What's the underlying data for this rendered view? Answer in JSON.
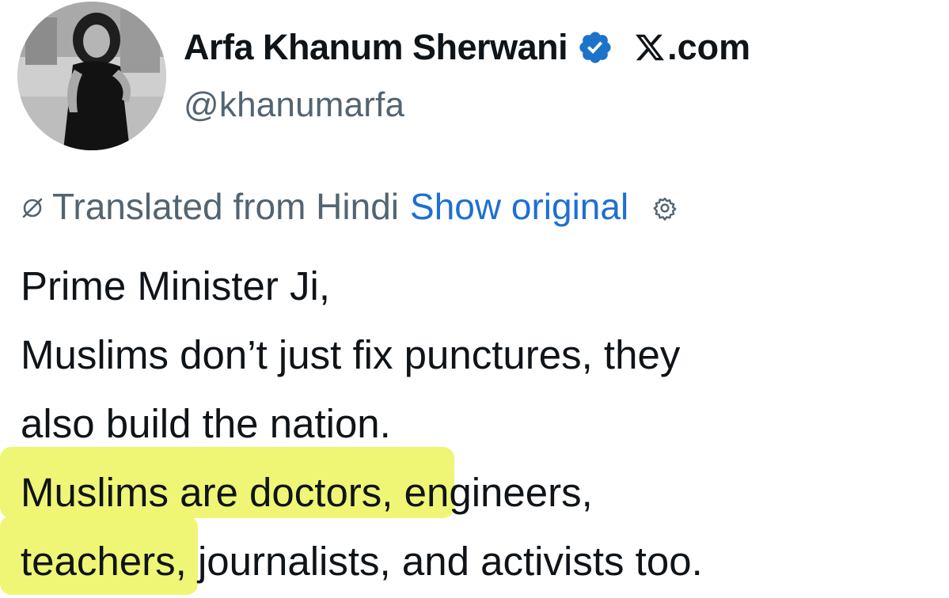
{
  "author": {
    "display_name": "Arfa Khanum Sherwani",
    "handle": "@khanumarfa",
    "verified_icon": "verified-badge-icon",
    "site_label": ".com",
    "site_logo_icon": "x-logo-icon"
  },
  "translation": {
    "label": "Translated from Hindi",
    "show_original": "Show original",
    "icon": "translate-icon",
    "settings_icon": "gear-icon"
  },
  "tweet": {
    "line1": "Prime Minister Ji,",
    "line2": "Muslims don’t just fix punctures, they",
    "line3": "also build the nation.",
    "line4_highlight": "Muslims are doctor",
    "line4_rest": "s, engineers,",
    "line5_highlight": "teacher",
    "line5_rest": "s, journalists, and activists too."
  },
  "colors": {
    "text": "#0f1419",
    "secondary": "#536471",
    "link": "#1d6fd3",
    "verified": "#1d73c9",
    "highlighter": "#eef56a"
  }
}
